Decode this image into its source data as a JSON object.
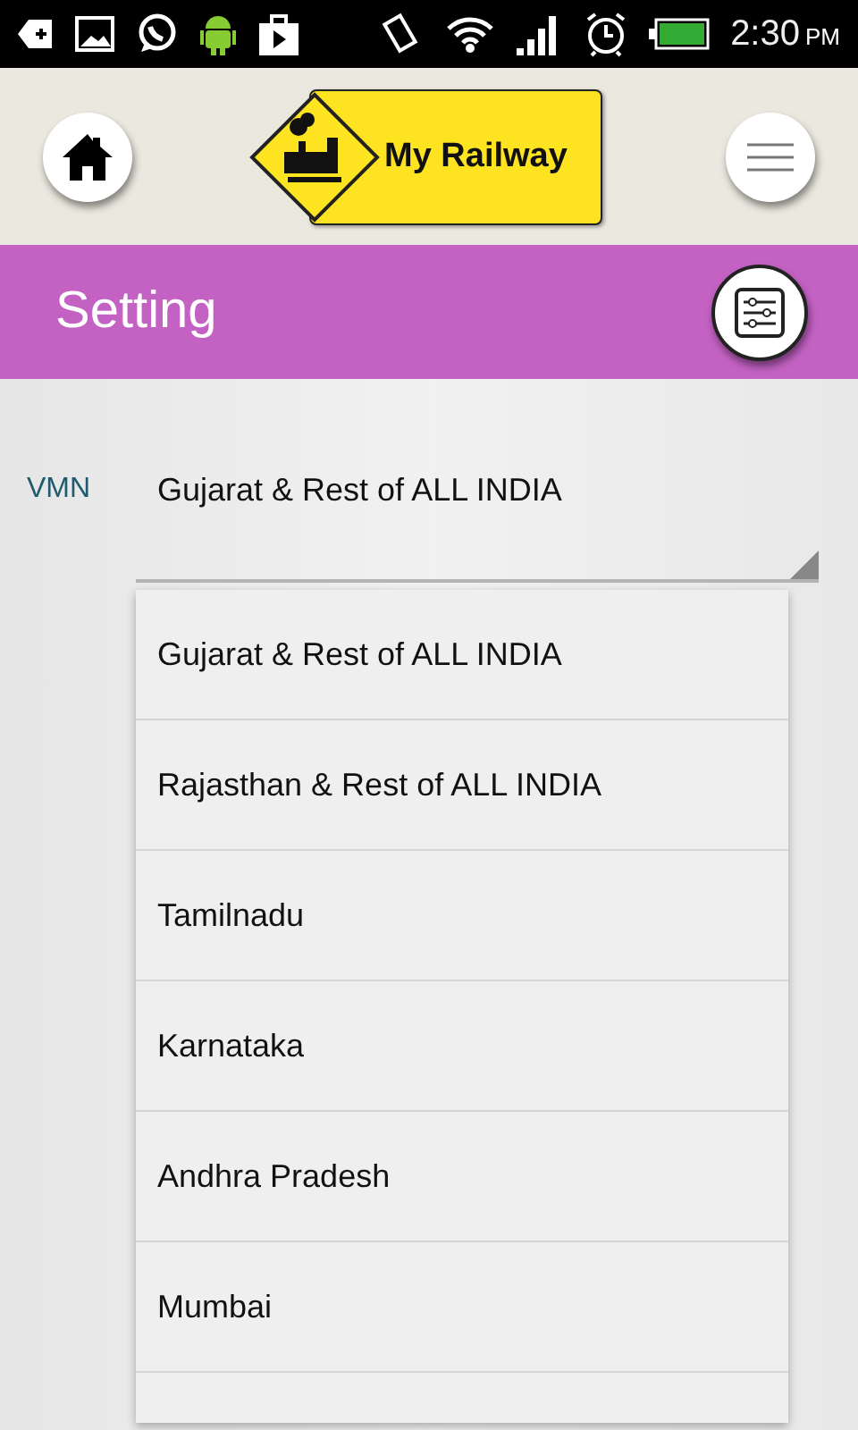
{
  "status_bar": {
    "time": "2:30",
    "meridiem": "PM"
  },
  "header": {
    "logo_text": "My Railway"
  },
  "title_bar": {
    "title": "Setting"
  },
  "vmn": {
    "label": "VMN",
    "value": "Gujarat & Rest of ALL INDIA"
  },
  "dropdown": {
    "options": [
      "Gujarat & Rest of ALL INDIA",
      "Rajasthan & Rest of ALL INDIA",
      "Tamilnadu",
      "Karnataka",
      "Andhra Pradesh",
      "Mumbai"
    ]
  }
}
